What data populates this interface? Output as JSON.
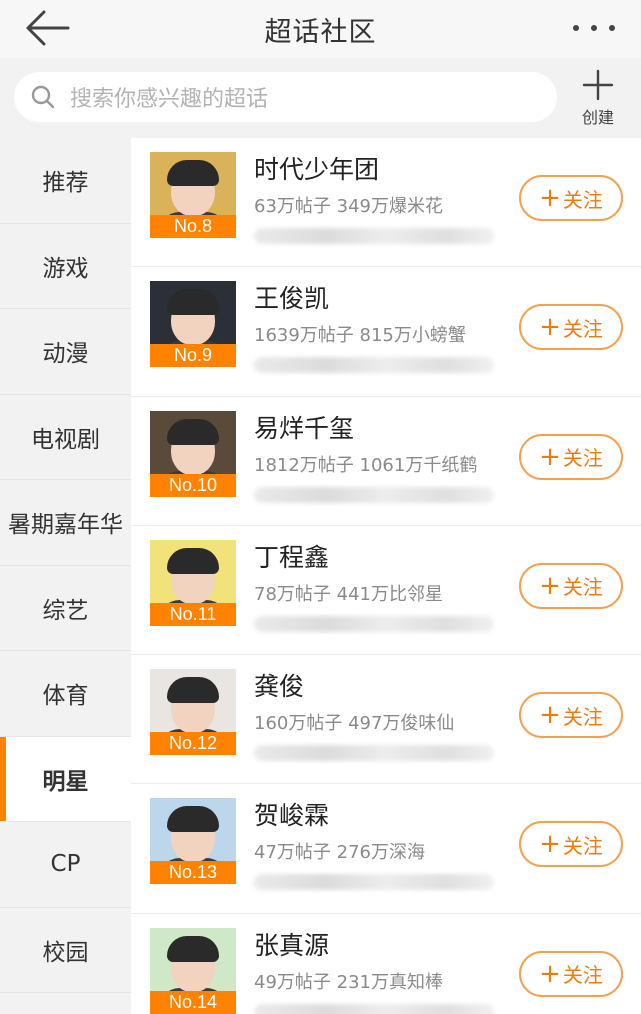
{
  "header": {
    "title": "超话社区"
  },
  "search": {
    "placeholder": "搜索你感兴趣的超话"
  },
  "create": {
    "label": "创建"
  },
  "sidebar": {
    "items": [
      {
        "label": "推荐"
      },
      {
        "label": "游戏"
      },
      {
        "label": "动漫"
      },
      {
        "label": "电视剧"
      },
      {
        "label": "暑期嘉年华"
      },
      {
        "label": "综艺"
      },
      {
        "label": "体育"
      },
      {
        "label": "明星",
        "active": true
      },
      {
        "label": "CP"
      },
      {
        "label": "校园"
      }
    ]
  },
  "follow_label": "关注",
  "follow_plus": "+",
  "list": {
    "items": [
      {
        "rank": "No.8",
        "name": "时代少年团",
        "stats": "63万帖子 349万爆米花",
        "thumb_color": "#d9b25a"
      },
      {
        "rank": "No.9",
        "name": "王俊凯",
        "stats": "1639万帖子 815万小螃蟹",
        "thumb_color": "#2b2f38"
      },
      {
        "rank": "No.10",
        "name": "易烊千玺",
        "stats": "1812万帖子 1061万千纸鹤",
        "thumb_color": "#5a4a3a"
      },
      {
        "rank": "No.11",
        "name": "丁程鑫",
        "stats": "78万帖子 441万比邻星",
        "thumb_color": "#f2e27a"
      },
      {
        "rank": "No.12",
        "name": "龚俊",
        "stats": "160万帖子 497万俊味仙",
        "thumb_color": "#e9e6e2"
      },
      {
        "rank": "No.13",
        "name": "贺峻霖",
        "stats": "47万帖子 276万深海",
        "thumb_color": "#bcd7ec"
      },
      {
        "rank": "No.14",
        "name": "张真源",
        "stats": "49万帖子 231万真知棒",
        "thumb_color": "#cfe9c8"
      }
    ]
  },
  "colors": {
    "accent": "#ff8200",
    "follow_border": "#f3a04f",
    "follow_text": "#ec7c10"
  }
}
